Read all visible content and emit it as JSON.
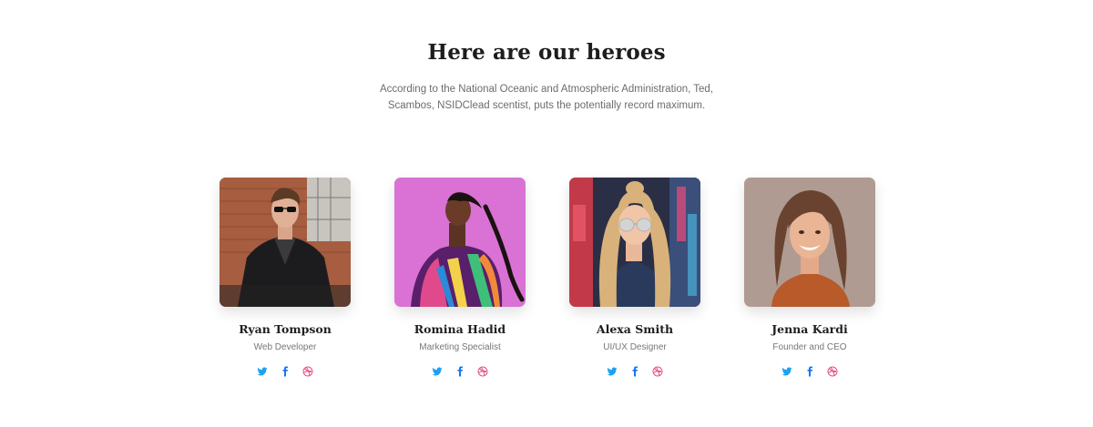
{
  "section": {
    "title": "Here are our heroes",
    "subtitle": "According to the National Oceanic and Atmospheric Administration, Ted, Scambos, NSIDClead scentist, puts the potentially record maximum."
  },
  "colors": {
    "twitter": "#1da1f2",
    "facebook": "#1877f2",
    "dribbble": "#ea4c89"
  },
  "team": [
    {
      "name": "Ryan Tompson",
      "role": "Web Developer",
      "photo_icon": "person-photo-icon",
      "socials": [
        "twitter-icon",
        "facebook-icon",
        "dribbble-icon"
      ]
    },
    {
      "name": "Romina Hadid",
      "role": "Marketing Specialist",
      "photo_icon": "person-photo-icon",
      "socials": [
        "twitter-icon",
        "facebook-icon",
        "dribbble-icon"
      ]
    },
    {
      "name": "Alexa Smith",
      "role": "UI/UX Designer",
      "photo_icon": "person-photo-icon",
      "socials": [
        "twitter-icon",
        "facebook-icon",
        "dribbble-icon"
      ]
    },
    {
      "name": "Jenna Kardi",
      "role": "Founder and CEO",
      "photo_icon": "person-photo-icon",
      "socials": [
        "twitter-icon",
        "facebook-icon",
        "dribbble-icon"
      ]
    }
  ]
}
